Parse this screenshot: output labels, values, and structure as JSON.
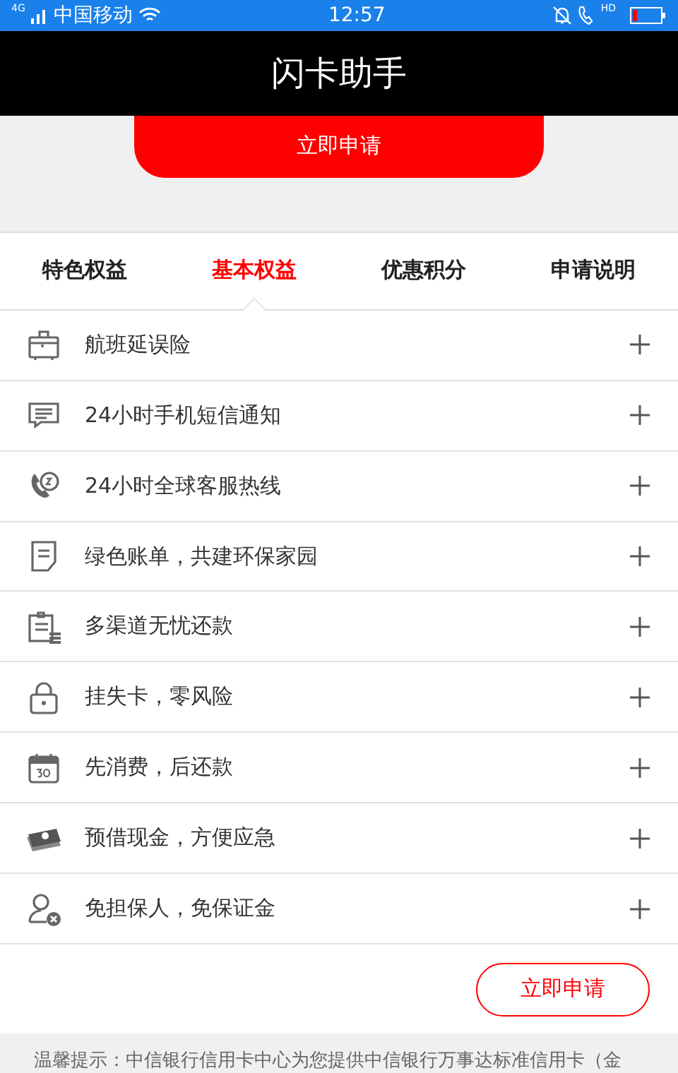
{
  "status_bar": {
    "network": "4G",
    "carrier": "中国移动",
    "time": "12:57",
    "call_badge": "HD"
  },
  "header": {
    "title": "闪卡助手"
  },
  "top_button": "立即申请",
  "tabs": [
    {
      "label": "特色权益",
      "selected": false
    },
    {
      "label": "基本权益",
      "selected": true
    },
    {
      "label": "优惠积分",
      "selected": false
    },
    {
      "label": "申请说明",
      "selected": false
    }
  ],
  "benefits": [
    {
      "label": "航班延误险",
      "expanded": false
    },
    {
      "label": "24小时手机短信通知",
      "expanded": false
    },
    {
      "label": "24小时全球客服热线",
      "expanded": false
    },
    {
      "label": "绿色账单，共建环保家园",
      "expanded": false
    },
    {
      "label": "多渠道无忧还款",
      "expanded": false
    },
    {
      "label": "挂失卡，零风险",
      "expanded": false
    },
    {
      "label": "先消费，后还款",
      "expanded": false
    },
    {
      "label": "预借现金，方便应急",
      "expanded": false
    },
    {
      "label": "免担保人，免保证金",
      "expanded": false
    }
  ],
  "bottom_button": "立即申请",
  "notice": "温馨提示：中信银行信用卡中心为您提供中信银行万事达标准信用卡（金"
}
